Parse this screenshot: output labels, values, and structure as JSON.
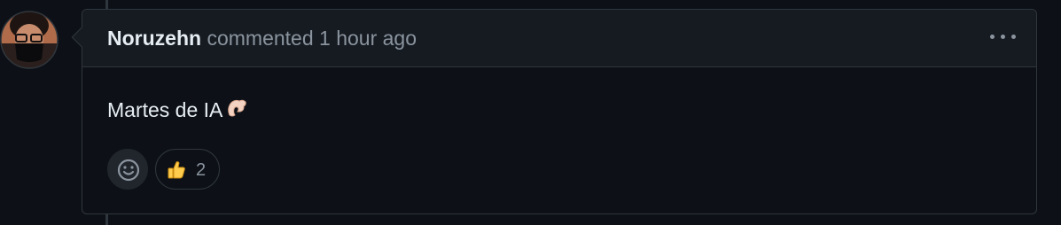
{
  "comment": {
    "author": "Noruzehn",
    "action": "commented",
    "timestamp": "1 hour ago",
    "body": "Martes de IA",
    "body_emoji": "pinching-hand-emoji",
    "menu_icon": "kebab-horizontal-icon"
  },
  "reactions": {
    "add_icon": "smiley-icon",
    "items": [
      {
        "emoji": "thumbs-up-emoji",
        "count": "2"
      }
    ]
  },
  "colors": {
    "background": "#0d1117",
    "header_background": "#161b22",
    "border": "#30363d",
    "muted_text": "#8b949e",
    "primary_text": "#e6edf3"
  }
}
